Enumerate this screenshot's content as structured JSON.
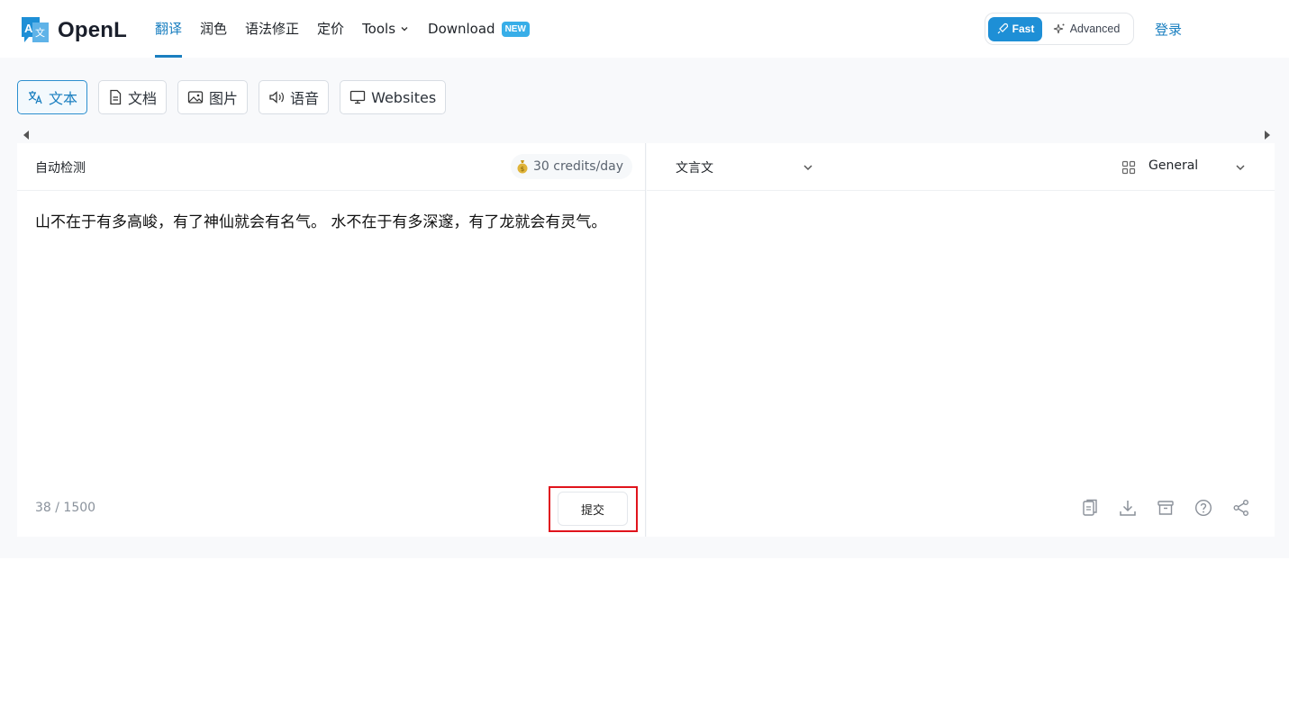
{
  "brand": {
    "name": "OpenL",
    "logo_letters": [
      "A",
      "文"
    ]
  },
  "nav": {
    "items": [
      {
        "label": "翻译",
        "active": true
      },
      {
        "label": "润色"
      },
      {
        "label": "语法修正"
      },
      {
        "label": "定价"
      },
      {
        "label": "Tools",
        "dropdown": true
      },
      {
        "label": "Download",
        "badge": "NEW"
      }
    ]
  },
  "mode": {
    "fast_label": "Fast",
    "advanced_label": "Advanced",
    "selected": "Fast"
  },
  "auth": {
    "login_label": "登录"
  },
  "input_types": [
    {
      "label": "文本",
      "icon": "translate-icon",
      "active": true
    },
    {
      "label": "文档",
      "icon": "document-icon"
    },
    {
      "label": "图片",
      "icon": "image-icon"
    },
    {
      "label": "语音",
      "icon": "speaker-icon"
    },
    {
      "label": "Websites",
      "icon": "monitor-icon"
    }
  ],
  "source": {
    "language": "自动检测",
    "credits": "30 credits/day",
    "text": "山不在于有多高峻，有了神仙就会有名气。 水不在于有多深邃，有了龙就会有灵气。",
    "char_count": "38 / 1500",
    "submit_label": "提交"
  },
  "target": {
    "language": "文言文",
    "domain": "General",
    "text": ""
  },
  "colors": {
    "accent": "#1a7fc0",
    "fast_bg": "#1e8fd6",
    "badge": "#38aee8",
    "highlight": "#e0141c"
  }
}
